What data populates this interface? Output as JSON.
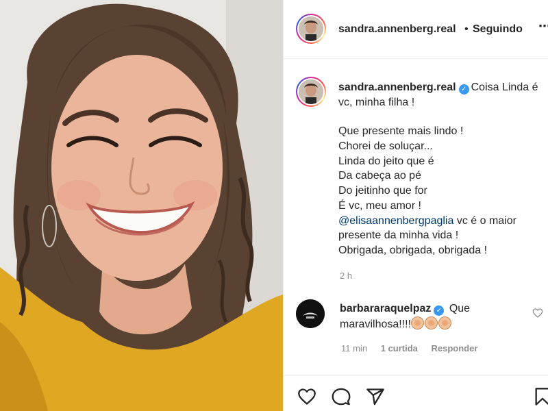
{
  "post": {
    "author": "sandra.annenberg.real",
    "follow_dot": "•",
    "follow_status": "Seguindo",
    "more_glyph": "⋯",
    "verified_glyph": "✓",
    "caption_first": "Coisa Linda é vc, minha filha !",
    "caption_lines": [
      "Que presente mais lindo !",
      "Chorei de soluçar...",
      "Linda do jeito que é",
      "Da cabeça ao pé",
      "Do jeitinho que for",
      "É vc, meu amor !"
    ],
    "mention": "@elisaannenbergpaglia",
    "mention_rest_1": " vc é o maior",
    "mention_rest_2": "presente da minha vida !",
    "caption_last": "Obrigada, obrigada, obrigada !",
    "time_ago": "2 h"
  },
  "comment": {
    "author": "barbararaquelpaz",
    "text_1": " Que",
    "text_2": "maravilhosa!!!!",
    "time": "11 min",
    "likes": "1 curtida",
    "reply": "Responder"
  },
  "icons": {
    "like": "heart-icon",
    "comment": "comment-icon",
    "share": "paper-plane-icon",
    "save": "bookmark-icon"
  }
}
